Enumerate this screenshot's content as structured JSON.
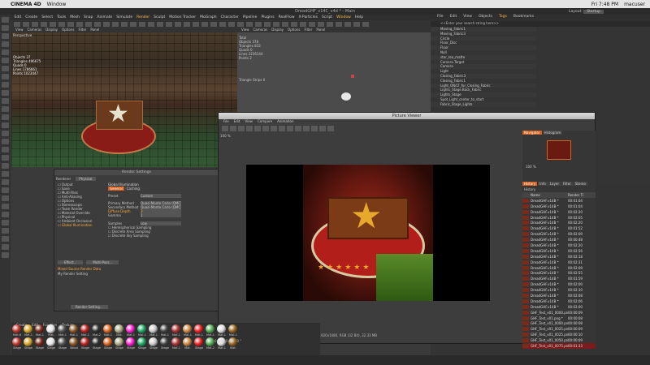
{
  "macos": {
    "apple": "",
    "app": "CINEMA 4D",
    "menu": "Window",
    "clock": "Fri 7:48 PM",
    "user": "macuser"
  },
  "c4d": {
    "title": "DreadGHF_v14C_v4d * - Main",
    "menus": [
      "File",
      "Edit",
      "Create",
      "Select",
      "Tools",
      "Mesh",
      "Snap",
      "Animate",
      "Simulate",
      "Render",
      "Sculpt",
      "Motion Tracker",
      "MoGraph",
      "Character",
      "Pipeline",
      "Plugins",
      "RealFlow",
      "X-Particles",
      "Script",
      "Window",
      "Help"
    ],
    "highlight_menus": [
      "Render",
      "Window"
    ],
    "layout_label": "Layout:",
    "layout_value": "Startup"
  },
  "viewport": {
    "menus": [
      "View",
      "Cameras",
      "Display",
      "Options",
      "Filter",
      "Panel"
    ],
    "camera_label": "Perspective"
  },
  "viewport_stats": {
    "rows": [
      [
        "Objects",
        "37"
      ],
      [
        "Triangles",
        "496675"
      ],
      [
        "Quads",
        "0"
      ],
      [
        "Lines",
        "1786661"
      ],
      [
        "Points",
        "1023447"
      ]
    ]
  },
  "center_stats": {
    "rows": [
      [
        "Total",
        ""
      ],
      [
        "Objects",
        "378"
      ],
      [
        "Triangles",
        "833"
      ],
      [
        "Quads",
        "0"
      ],
      [
        "Lines",
        "2236144"
      ],
      [
        "Points",
        "2"
      ]
    ],
    "selected": "Triangle Strips  0"
  },
  "object_manager": {
    "menus": [
      "File",
      "Edit",
      "View",
      "Objects",
      "Tags",
      "Bookmarks"
    ],
    "search_placeholder": "<<Enter your search string here>>",
    "objects": [
      "Moving_Fabric1",
      "Moving_Fabric3",
      "Circle",
      "Floor_Disc",
      "Floor",
      "Null",
      "star_tea_matte",
      "Camera.Target",
      "Camera",
      "Light",
      "Closing_Fabric3",
      "Closing_Fabric1",
      "Light_ON/LT_for_Closing_Fabric",
      "Lights_Stage.Back_Fabric",
      "Lights_Stage",
      "Spot_Light_center_to_start",
      "Fabric_Stage_Lights"
    ]
  },
  "render_settings": {
    "title": "Render Settings",
    "renderer_label": "Renderer",
    "renderer_value": "Physical",
    "items": [
      "Output",
      "Save",
      "Multi-Pass",
      "Anti-Aliasing",
      "Options",
      "Stereoscopic",
      "Team Render",
      "Material Override",
      "Physical",
      "Ambient Occlusion",
      "Global Illumination"
    ],
    "selected_item": "Global Illumination",
    "section": "Global Illumination",
    "tabs": [
      "General",
      "Caching"
    ],
    "preset_label": "Preset",
    "preset_value": "Custom",
    "primary_label": "Primary Method",
    "primary_value": "Quasi-Monte Carlo (QMC)",
    "secondary_label": "Secondary Method",
    "secondary_value": "Quasi-Monte Carlo (QMC)",
    "diffuse_label": "Diffuse Depth",
    "diffuse_value": "3",
    "gamma_label": "Gamma",
    "gamma_value": "1",
    "samples_label": "Samples",
    "samples_value": "Low",
    "checks": [
      "Hemispherical Sampling",
      "Discrete Area Sampling",
      "Discrete Sky Sampling"
    ],
    "effect_button": "Effect...",
    "multipass_button": "Multi-Pass...",
    "my_render": "My Render Setting",
    "marker": "Mixed Source Render Data",
    "footer_button": "Render Setting..."
  },
  "picture_viewer": {
    "title": "Picture Viewer",
    "menus": [
      "File",
      "Edit",
      "View",
      "Compare",
      "Animation"
    ],
    "zoom": "100 %",
    "status_left": "100 %",
    "status_mid": "00:01:33",
    "status_info": "Size: 1920x1080, RGB (32 Bit), 32.33 MB",
    "side_tabs": [
      "Navigator",
      "Histogram"
    ],
    "history_tabs": [
      "History",
      "Info",
      "Layer",
      "Filter",
      "Stereo"
    ],
    "history_header": "History",
    "col_name": "Name",
    "col_time": "Render Ti",
    "history": [
      [
        "DreadGHF.v14B *",
        "00:01:04"
      ],
      [
        "DreadGHF.v14B *",
        "00:01:04"
      ],
      [
        "DreadGHF.v14B *",
        "00:02:20"
      ],
      [
        "DreadGHF.v14B *",
        "00:02:05"
      ],
      [
        "DreadGHF.v14B *",
        "00:02:20"
      ],
      [
        "DreadGHF.v14B *",
        "00:01:52"
      ],
      [
        "DreadGHF.v14B *",
        "00:02:09"
      ],
      [
        "DreadGHF.v14B *",
        "00:00:48"
      ],
      [
        "DreadGHF.v14B *",
        "00:02:20"
      ],
      [
        "DreadGHF.v14B *",
        "00:02:56"
      ],
      [
        "DreadGHF.v14B *",
        "00:02:18"
      ],
      [
        "DreadGHF.v14B *",
        "00:02:31"
      ],
      [
        "DreadGHF.v14B *",
        "00:02:09"
      ],
      [
        "DreadGHF.v14B *",
        "00:02:55"
      ],
      [
        "DreadGHF.v14B *",
        "00:01:59"
      ],
      [
        "DreadGHF.v14B *",
        "00:02:00"
      ],
      [
        "DreadGHF.v14B *",
        "00:02:10"
      ],
      [
        "DreadGHF.v14B *",
        "00:02:08"
      ],
      [
        "DreadGHF.v14B *",
        "00:02:06"
      ],
      [
        "DreadGHF.v14B *",
        "00:02:00"
      ],
      [
        "GHF_Test_v01_0000.png *",
        "00:00:09"
      ],
      [
        "GHF_Test_v01.png *",
        "00:00:08"
      ],
      [
        "GHF_Test_v01_0000.png *",
        "00:00:08"
      ],
      [
        "GHF_Test_v01_0025.png *",
        "00:00:09"
      ],
      [
        "GHF_Test_v01_0025.png *",
        "00:00:10"
      ],
      [
        "GHF_Test_v01_0050.png *",
        "00:00:09"
      ],
      [
        "GHF_Test_v01_0075.png *",
        "00:01:33"
      ]
    ]
  },
  "material_manager": {
    "menus": [
      "Create",
      "Edit",
      "Function",
      "Texture"
    ],
    "row1_labels": [
      "Mat.8",
      "Mat.1",
      "Mat.1",
      "Mat.",
      "Mat.1",
      "Mat.1",
      "Mat.1",
      "Mat.2",
      "Mat.1",
      "Mat.",
      "Mat.1",
      "Mat.1",
      "Mat.1",
      "Mat.1",
      "Mat.1",
      "Mat.1",
      "Mat.1",
      "Mat.1",
      "Mat.1",
      "Mat.1"
    ],
    "row2_labels": [
      "Stage",
      "Stage",
      "Stage",
      "Stage",
      "Stage",
      "Wood",
      "Stage",
      "Stage",
      "Stage",
      "Stage",
      "Stage",
      "Stage",
      "Stage",
      "Stage",
      "Mat.1",
      "Mat.",
      "Stage",
      "Mat.2",
      "Mat.1",
      "Mat."
    ]
  },
  "coords": {
    "position": "0 cm",
    "size": "0 cm",
    "rotation": "0 °"
  },
  "colors": {
    "accent": "#ffaa3c",
    "selection": "#d0601c",
    "history_sel": "#7a1c1c"
  }
}
